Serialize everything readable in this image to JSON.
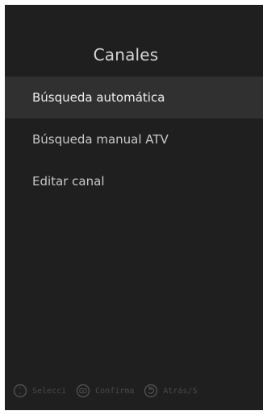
{
  "header": {
    "title": "Canales"
  },
  "menu": {
    "items": [
      {
        "label": "Búsqueda automática",
        "selected": true
      },
      {
        "label": "Búsqueda manual ATV",
        "selected": false
      },
      {
        "label": "Editar canal",
        "selected": false
      }
    ]
  },
  "footer": {
    "hints": [
      {
        "icon": "dpad-icon",
        "label": "Selecci"
      },
      {
        "icon": "ok-button-icon",
        "label": "Confirma"
      },
      {
        "icon": "back-icon",
        "label": "Atrás/S"
      }
    ]
  }
}
